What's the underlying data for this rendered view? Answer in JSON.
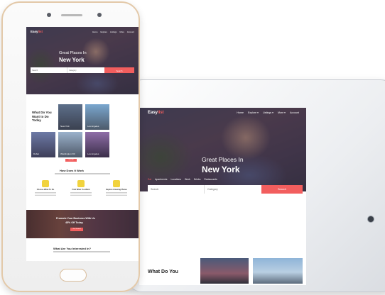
{
  "brand": {
    "name_part1": "Easy",
    "name_part2": "list",
    "accent_color": "#f25e5e"
  },
  "tablet": {
    "nav": [
      "Home",
      "Explore ▾",
      "Listings ▾",
      "More ▾",
      "Account"
    ],
    "hero": {
      "line1": "Great Places In",
      "line2": "New York"
    },
    "categories": [
      "Eat",
      "Apartments",
      "Locations",
      "Work",
      "Drinks",
      "Restaurants"
    ],
    "search": {
      "placeholder": "Search",
      "category_label": "Category",
      "button": "Search"
    },
    "section_title": "What Do You"
  },
  "phone": {
    "nav": [
      "Home",
      "Explore",
      "Listings",
      "More",
      "Account"
    ],
    "hero": {
      "line1": "Great Places In",
      "line2": "New York"
    },
    "search": {
      "placeholder": "Search",
      "category_label": "Category",
      "button": "Search"
    },
    "section_title": "What Do You Want to Do Today",
    "tiles": [
      "New York",
      "Los Angeles",
      "Dubai",
      "Washington DC",
      "Los Angeles"
    ],
    "view_button": "View All",
    "how_title": "How Does It Work",
    "steps": [
      "Choose What To Do",
      "Find What You Want",
      "Explore Amazing Places"
    ],
    "promo": {
      "line1": "Promote Your Business With Us",
      "line2": "45% Off Today",
      "button": "Get Started"
    },
    "interest_title": "What Are You Interested In?"
  }
}
